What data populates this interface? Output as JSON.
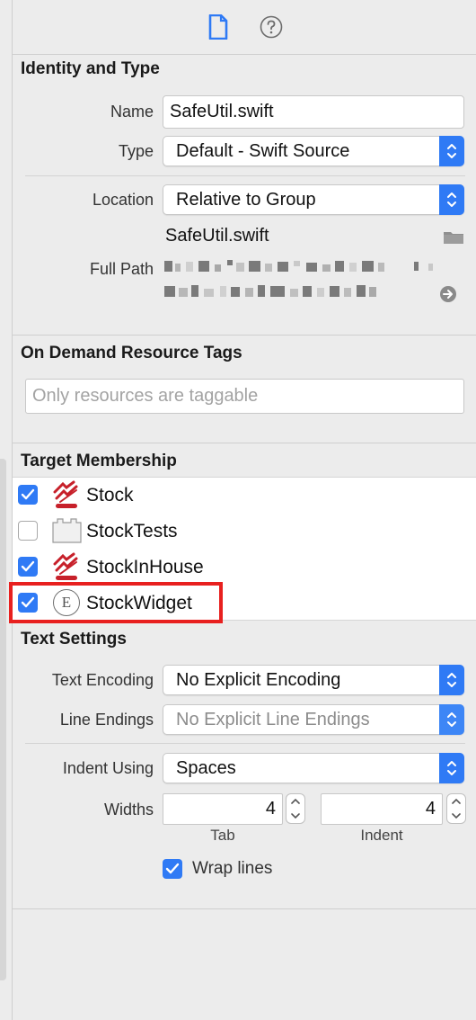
{
  "toolbar": {
    "file_icon": "file-icon",
    "help_icon": "help-circle-icon"
  },
  "identity": {
    "title": "Identity and Type",
    "name_label": "Name",
    "name_value": "SafeUtil.swift",
    "type_label": "Type",
    "type_value": "Default - Swift Source",
    "location_label": "Location",
    "location_value": "Relative to Group",
    "file_name": "SafeUtil.swift",
    "full_path_label": "Full Path"
  },
  "on_demand": {
    "title": "On Demand Resource Tags",
    "placeholder": "Only resources are taggable"
  },
  "target_membership": {
    "title": "Target Membership",
    "items": [
      {
        "label": "Stock",
        "checked": true
      },
      {
        "label": "StockTests",
        "checked": false
      },
      {
        "label": "StockInHouse",
        "checked": true
      },
      {
        "label": "StockWidget",
        "checked": true,
        "highlighted": true
      }
    ],
    "extension_glyph": "E"
  },
  "text_settings": {
    "title": "Text Settings",
    "encoding_label": "Text Encoding",
    "encoding_value": "No Explicit Encoding",
    "line_endings_label": "Line Endings",
    "line_endings_value": "No Explicit Line Endings",
    "indent_using_label": "Indent Using",
    "indent_using_value": "Spaces",
    "widths_label": "Widths",
    "tab_value": "4",
    "indent_value": "4",
    "tab_caption": "Tab",
    "indent_caption": "Indent",
    "wrap_lines_label": "Wrap lines",
    "wrap_lines_checked": true
  },
  "colors": {
    "accent": "#2f7af5",
    "highlight_box": "#e8201f"
  }
}
